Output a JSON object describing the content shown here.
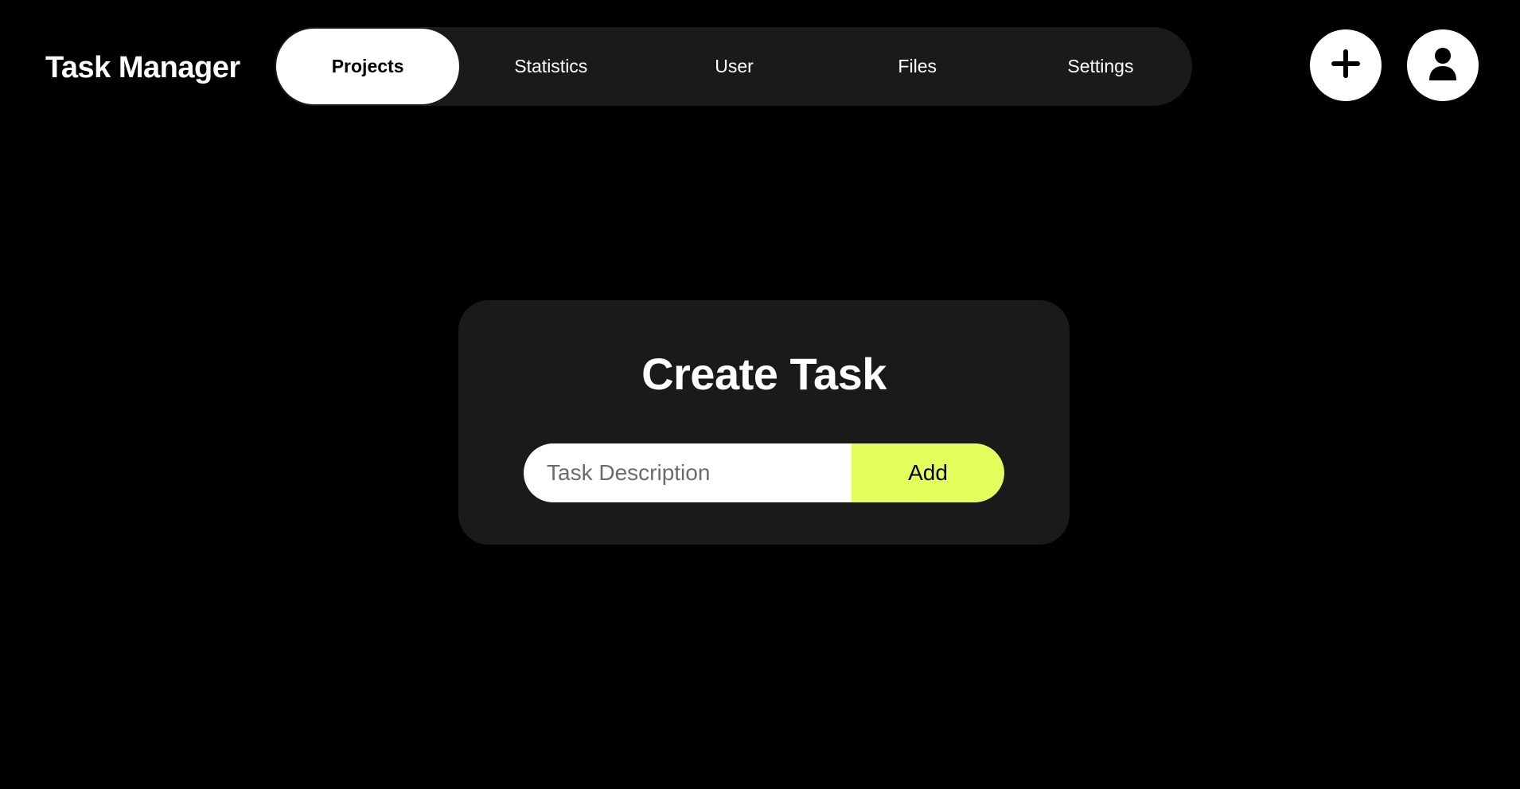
{
  "app": {
    "title": "Task Manager"
  },
  "nav": {
    "tabs": [
      {
        "label": "Projects",
        "active": true
      },
      {
        "label": "Statistics",
        "active": false
      },
      {
        "label": "User",
        "active": false
      },
      {
        "label": "Files",
        "active": false
      },
      {
        "label": "Settings",
        "active": false
      }
    ]
  },
  "header_actions": {
    "add_icon": "plus-icon",
    "user_icon": "person-icon"
  },
  "create_task": {
    "title": "Create Task",
    "input_value": "",
    "input_placeholder": "Task Description",
    "add_label": "Add"
  },
  "colors": {
    "background": "#000000",
    "surface": "#1a1a1a",
    "accent": "#e4ff5c",
    "text": "#ffffff"
  }
}
